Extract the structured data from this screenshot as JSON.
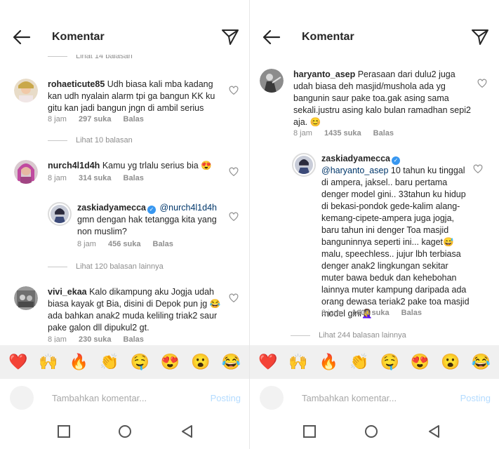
{
  "header": {
    "title": "Komentar"
  },
  "left": {
    "top_partial_replies": "Lihat 14 balasan",
    "comments": [
      {
        "username": "rohaeticute85",
        "text": "Udh biasa kali mba kadang kan udh nyalain alarm tpi ga bangun KK ku gitu kan jadi bangun jngn di ambil serius",
        "time": "8 jam",
        "likes": "297 suka",
        "reply": "Balas",
        "view_replies": "Lihat 10 balasan"
      },
      {
        "username": "nurch4l1d4h",
        "text": "Kamu yg trlalu serius bia 😍",
        "time": "8 jam",
        "likes": "314 suka",
        "reply": "Balas"
      },
      {
        "username": "zaskiadyamecca",
        "mention": "@nurch4l1d4h",
        "text": "gmn dengan hak tetangga kita yang non muslim?",
        "time": "8 jam",
        "likes": "456 suka",
        "reply": "Balas",
        "view_replies": "Lihat 120 balasan lainnya"
      },
      {
        "username": "vivi_ekaa",
        "text": "Kalo dikampung aku Jogja udah biasa kayak gt Bia, disini di Depok pun jg 😂ada bahkan anak2 muda keliling triak2 saur pake galon dll dipukul2 gt.",
        "time": "8 jam",
        "likes": "230 suka",
        "reply": "Balas"
      }
    ]
  },
  "right": {
    "comments": [
      {
        "username": "haryanto_asep",
        "text": "Perasaan dari dulu2 juga udah biasa deh masjid/mushola ada yg bangunin saur pake toa.gak asing sama sekali.justru asing kalo bulan ramadhan sepi2 aja. 😊",
        "time": "8 jam",
        "likes": "1435 suka",
        "reply": "Balas"
      },
      {
        "username": "zaskiadyamecca",
        "mention": "@haryanto_asep",
        "text": "10 tahun ku tinggal di ampera, jaksel.. baru pertama denger model gini.. 33tahun ku hidup di bekasi-pondok gede-kalim alang-kemang-cipete-ampera juga jogja, baru tahun ini denger Toa masjid banguninnya seperti ini... kaget😅 malu, speechless.. jujur lbh terbiasa denger anak2 lingkungan sekitar muter bawa beduk dan kehebohan lainnya muter kampung daripada ada orang dewasa teriak2 pake toa masjid model gini🤦‍♀️",
        "time": "8 jam",
        "likes": "1600 suka",
        "reply": "Balas",
        "view_replies": "Lihat 244 balasan lainnya"
      }
    ]
  },
  "emojis": [
    "❤️",
    "🙌",
    "🔥",
    "👏",
    "🤤",
    "😍",
    "😮",
    "😂"
  ],
  "compose": {
    "placeholder": "Tambahkan komentar...",
    "post_label": "Posting"
  },
  "colors": {
    "verified": "#3897f0",
    "post_disabled": "#b3dbff",
    "emoji_bar": "#f0f0f0"
  }
}
